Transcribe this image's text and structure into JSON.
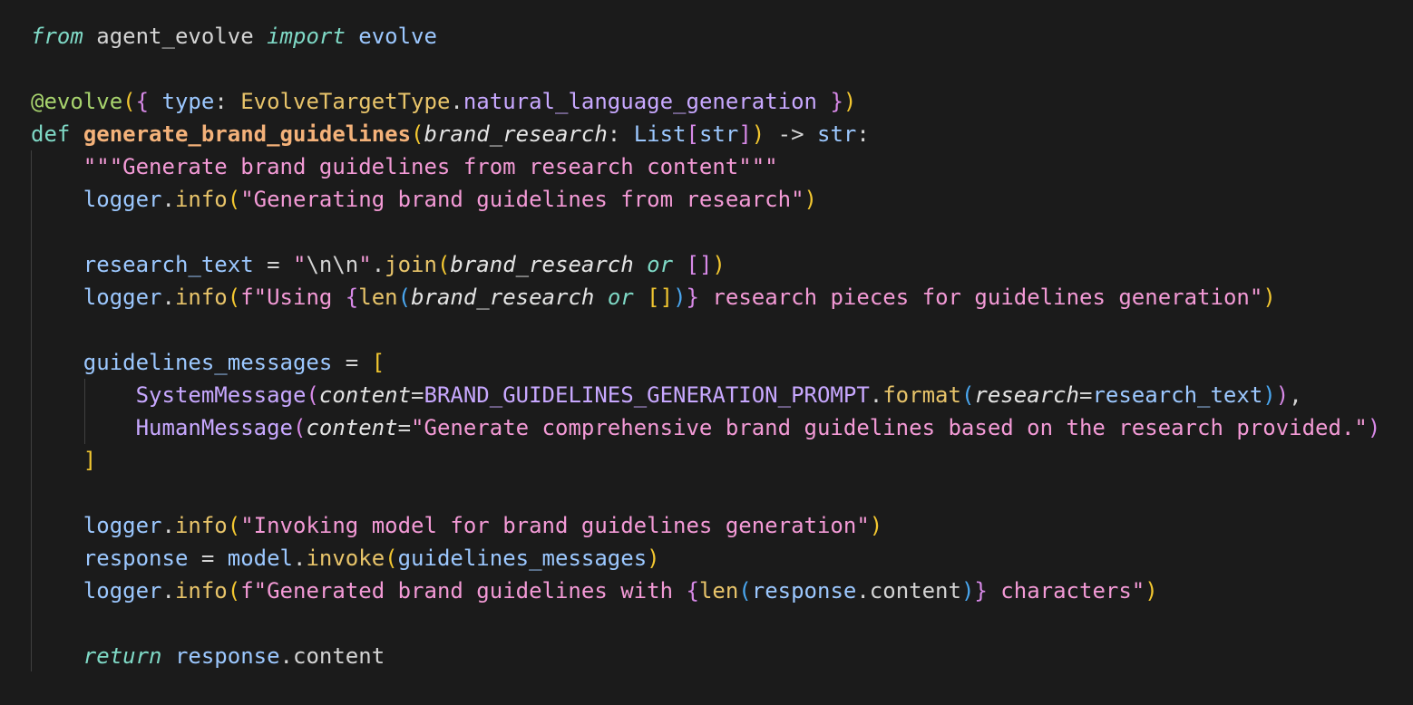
{
  "editor": {
    "lines": [
      [
        {
          "t": "from",
          "c": "kw-italic"
        },
        {
          "t": " agent_evolve ",
          "c": "ident"
        },
        {
          "t": "import",
          "c": "kw-italic"
        },
        {
          "t": " evolve",
          "c": "var"
        }
      ],
      [],
      [
        {
          "t": "@evolve",
          "c": "deco"
        },
        {
          "t": "(",
          "c": "b1"
        },
        {
          "t": "{",
          "c": "b2"
        },
        {
          "t": " type",
          "c": "var"
        },
        {
          "t": ": ",
          "c": "op"
        },
        {
          "t": "EvolveTargetType",
          "c": "enumcls"
        },
        {
          "t": ".",
          "c": "op"
        },
        {
          "t": "natural_language_generation",
          "c": "const"
        },
        {
          "t": " ",
          "c": "op"
        },
        {
          "t": "}",
          "c": "b2"
        },
        {
          "t": ")",
          "c": "b1"
        }
      ],
      [
        {
          "t": "def",
          "c": "kw"
        },
        {
          "t": " ",
          "c": "op"
        },
        {
          "t": "generate_brand_guidelines",
          "c": "fn"
        },
        {
          "t": "(",
          "c": "b1"
        },
        {
          "t": "brand_research",
          "c": "param"
        },
        {
          "t": ": ",
          "c": "op"
        },
        {
          "t": "List",
          "c": "type"
        },
        {
          "t": "[",
          "c": "b2"
        },
        {
          "t": "str",
          "c": "type"
        },
        {
          "t": "]",
          "c": "b2"
        },
        {
          "t": ")",
          "c": "b1"
        },
        {
          "t": " -> ",
          "c": "op"
        },
        {
          "t": "str",
          "c": "type"
        },
        {
          "t": ":",
          "c": "op"
        }
      ],
      [
        {
          "t": "    ",
          "c": "op"
        },
        {
          "t": "\"\"\"Generate brand guidelines from research content\"\"\"",
          "c": "str"
        }
      ],
      [
        {
          "t": "    ",
          "c": "op"
        },
        {
          "t": "logger",
          "c": "var"
        },
        {
          "t": ".",
          "c": "op"
        },
        {
          "t": "info",
          "c": "method"
        },
        {
          "t": "(",
          "c": "b1"
        },
        {
          "t": "\"Generating brand guidelines from research\"",
          "c": "str"
        },
        {
          "t": ")",
          "c": "b1"
        }
      ],
      [],
      [
        {
          "t": "    ",
          "c": "op"
        },
        {
          "t": "research_text",
          "c": "var"
        },
        {
          "t": " = ",
          "c": "op"
        },
        {
          "t": "\"",
          "c": "str"
        },
        {
          "t": "\\n\\n",
          "c": "op"
        },
        {
          "t": "\"",
          "c": "str"
        },
        {
          "t": ".",
          "c": "op"
        },
        {
          "t": "join",
          "c": "method"
        },
        {
          "t": "(",
          "c": "b1"
        },
        {
          "t": "brand_research",
          "c": "param"
        },
        {
          "t": " ",
          "c": "op"
        },
        {
          "t": "or",
          "c": "kw-italic"
        },
        {
          "t": " ",
          "c": "op"
        },
        {
          "t": "[]",
          "c": "b2"
        },
        {
          "t": ")",
          "c": "b1"
        }
      ],
      [
        {
          "t": "    ",
          "c": "op"
        },
        {
          "t": "logger",
          "c": "var"
        },
        {
          "t": ".",
          "c": "op"
        },
        {
          "t": "info",
          "c": "method"
        },
        {
          "t": "(",
          "c": "b1"
        },
        {
          "t": "f\"Using ",
          "c": "str"
        },
        {
          "t": "{",
          "c": "b2"
        },
        {
          "t": "len",
          "c": "method"
        },
        {
          "t": "(",
          "c": "b3"
        },
        {
          "t": "brand_research",
          "c": "param"
        },
        {
          "t": " ",
          "c": "op"
        },
        {
          "t": "or",
          "c": "kw-italic"
        },
        {
          "t": " ",
          "c": "op"
        },
        {
          "t": "[]",
          "c": "b1"
        },
        {
          "t": ")",
          "c": "b3"
        },
        {
          "t": "}",
          "c": "b2"
        },
        {
          "t": " research pieces for guidelines generation\"",
          "c": "str"
        },
        {
          "t": ")",
          "c": "b1"
        }
      ],
      [],
      [
        {
          "t": "    ",
          "c": "op"
        },
        {
          "t": "guidelines_messages",
          "c": "var"
        },
        {
          "t": " = ",
          "c": "op"
        },
        {
          "t": "[",
          "c": "b1"
        }
      ],
      [
        {
          "t": "        ",
          "c": "op"
        },
        {
          "t": "SystemMessage",
          "c": "cls"
        },
        {
          "t": "(",
          "c": "b2"
        },
        {
          "t": "content",
          "c": "param"
        },
        {
          "t": "=",
          "c": "op"
        },
        {
          "t": "BRAND_GUIDELINES_GENERATION_PROMPT",
          "c": "const"
        },
        {
          "t": ".",
          "c": "op"
        },
        {
          "t": "format",
          "c": "method"
        },
        {
          "t": "(",
          "c": "b3"
        },
        {
          "t": "research",
          "c": "param"
        },
        {
          "t": "=",
          "c": "op"
        },
        {
          "t": "research_text",
          "c": "var"
        },
        {
          "t": ")",
          "c": "b3"
        },
        {
          "t": ")",
          "c": "b2"
        },
        {
          "t": ",",
          "c": "op"
        }
      ],
      [
        {
          "t": "        ",
          "c": "op"
        },
        {
          "t": "HumanMessage",
          "c": "cls"
        },
        {
          "t": "(",
          "c": "b2"
        },
        {
          "t": "content",
          "c": "param"
        },
        {
          "t": "=",
          "c": "op"
        },
        {
          "t": "\"Generate comprehensive brand guidelines based on the research provided.\"",
          "c": "str"
        },
        {
          "t": ")",
          "c": "b2"
        }
      ],
      [
        {
          "t": "    ",
          "c": "op"
        },
        {
          "t": "]",
          "c": "b1"
        }
      ],
      [],
      [
        {
          "t": "    ",
          "c": "op"
        },
        {
          "t": "logger",
          "c": "var"
        },
        {
          "t": ".",
          "c": "op"
        },
        {
          "t": "info",
          "c": "method"
        },
        {
          "t": "(",
          "c": "b1"
        },
        {
          "t": "\"Invoking model for brand guidelines generation\"",
          "c": "str"
        },
        {
          "t": ")",
          "c": "b1"
        }
      ],
      [
        {
          "t": "    ",
          "c": "op"
        },
        {
          "t": "response",
          "c": "var"
        },
        {
          "t": " = ",
          "c": "op"
        },
        {
          "t": "model",
          "c": "var"
        },
        {
          "t": ".",
          "c": "op"
        },
        {
          "t": "invoke",
          "c": "method"
        },
        {
          "t": "(",
          "c": "b1"
        },
        {
          "t": "guidelines_messages",
          "c": "var"
        },
        {
          "t": ")",
          "c": "b1"
        }
      ],
      [
        {
          "t": "    ",
          "c": "op"
        },
        {
          "t": "logger",
          "c": "var"
        },
        {
          "t": ".",
          "c": "op"
        },
        {
          "t": "info",
          "c": "method"
        },
        {
          "t": "(",
          "c": "b1"
        },
        {
          "t": "f\"Generated brand guidelines with ",
          "c": "str"
        },
        {
          "t": "{",
          "c": "b2"
        },
        {
          "t": "len",
          "c": "method"
        },
        {
          "t": "(",
          "c": "b3"
        },
        {
          "t": "response",
          "c": "var"
        },
        {
          "t": ".",
          "c": "op"
        },
        {
          "t": "content",
          "c": "ident"
        },
        {
          "t": ")",
          "c": "b3"
        },
        {
          "t": "}",
          "c": "b2"
        },
        {
          "t": " characters\"",
          "c": "str"
        },
        {
          "t": ")",
          "c": "b1"
        }
      ],
      [],
      [
        {
          "t": "    ",
          "c": "op"
        },
        {
          "t": "return",
          "c": "kw-italic"
        },
        {
          "t": " ",
          "c": "op"
        },
        {
          "t": "response",
          "c": "var"
        },
        {
          "t": ".",
          "c": "op"
        },
        {
          "t": "content",
          "c": "ident"
        }
      ]
    ]
  }
}
